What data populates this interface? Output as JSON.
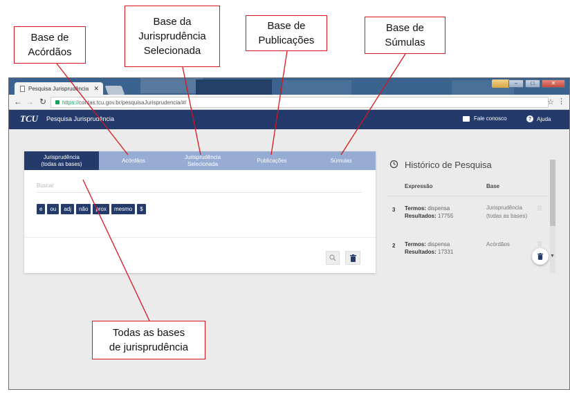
{
  "callouts": {
    "acordaos": "Base de\nAcórdãos",
    "jurisprudencia_selecionada": "Base da\nJurisprudência\nSelecionada",
    "publicacoes": "Base de\nPublicações",
    "sumulas": "Base de\nSúmulas",
    "todas_bases": "Todas as bases\nde jurisprudência"
  },
  "browser": {
    "tab_title": "Pesquisa Jurisprudência",
    "tab_close": "✕",
    "url_scheme": "https://",
    "url_rest": "contas.tcu.gov.br/pesquisaJurisprudencia/#/"
  },
  "navbar": {
    "logo": "TCU",
    "title": "Pesquisa Jurisprudência",
    "contact": "Fale conosco",
    "help": "Ajuda"
  },
  "tabs": [
    {
      "label": "Jurisprudência\n(todas as bases)",
      "active": true
    },
    {
      "label": "Acórdãos",
      "active": false
    },
    {
      "label": "Jurisprudência\nSelecionada",
      "active": false
    },
    {
      "label": "Publicações",
      "active": false
    },
    {
      "label": "Súmulas",
      "active": false
    }
  ],
  "search": {
    "placeholder": "Buscar",
    "operators": [
      "e",
      "ou",
      "adj",
      "não",
      "prox",
      "mesmo",
      "$"
    ]
  },
  "history": {
    "title": "Histórico de Pesquisa",
    "col_expression": "Expressão",
    "col_base": "Base",
    "entries": [
      {
        "num": "3",
        "terms_label": "Termos:",
        "terms": "dispensa",
        "results_label": "Resultados:",
        "results": "17755",
        "base": "Jurisprudência (todas as bases)"
      },
      {
        "num": "2",
        "terms_label": "Termos:",
        "terms": "dispensa",
        "results_label": "Resultados:",
        "results": "17331",
        "base": "Acórdãos"
      }
    ]
  },
  "colors": {
    "callout_border": "#d9141c",
    "navbar": "#233a6a",
    "tab_inactive": "#97acd3",
    "tab_active": "#233a6a"
  }
}
